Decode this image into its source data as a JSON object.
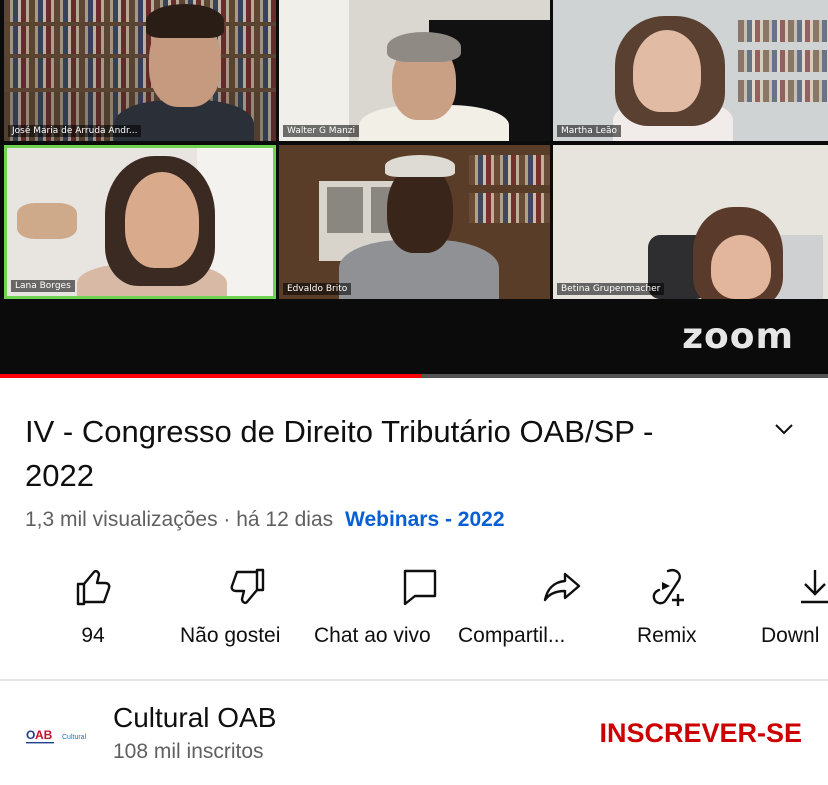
{
  "video": {
    "participants": [
      "José Maria de Arruda Andr...",
      "Walter G Manzi",
      "Martha Leão",
      "Lana Borges",
      "Edvaldo Brito",
      "Betina Grupenmacher"
    ],
    "watermark": "zoom",
    "progress_fraction": 0.51
  },
  "title": "IV - Congresso de Direito Tributário OAB/SP - 2022",
  "meta": {
    "stats": "1,3 mil visualizações · há 12 dias",
    "playlist": "Webinars - 2022"
  },
  "actions": {
    "like_count": "94",
    "dislike_label": "Não gostei",
    "chat_label": "Chat ao vivo",
    "share_label": "Compartil...",
    "remix_label": "Remix",
    "download_label": "Downl"
  },
  "channel": {
    "name": "Cultural OAB",
    "subscribers": "108 mil inscritos",
    "logo_text": "OAB",
    "logo_sub": "Cultural",
    "subscribe_label": "INSCREVER-SE"
  },
  "colors": {
    "accent_red": "#ff0000",
    "subscribe_red": "#cc0000",
    "link_blue": "#065fd4",
    "active_speaker": "#6ed34f"
  }
}
